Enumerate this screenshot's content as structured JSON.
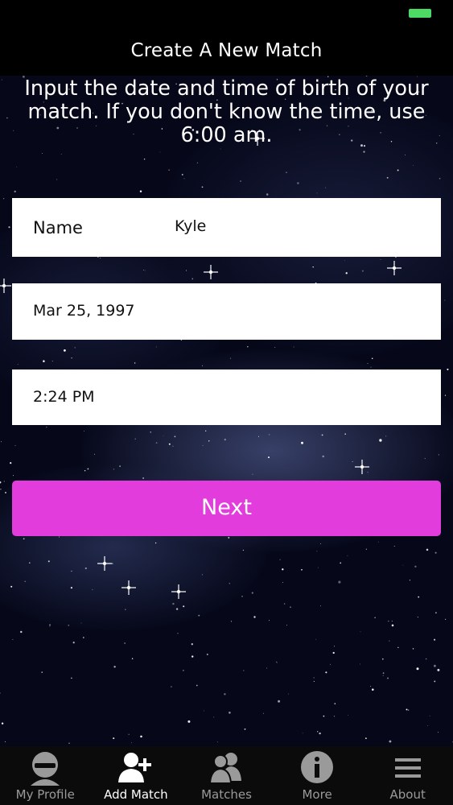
{
  "status_bar": {
    "battery_color": "#4cd964"
  },
  "header": {
    "title": "Create A New Match"
  },
  "instructions": "Input the date and time of birth of your match. If you don't know the time, use 6:00 am.",
  "form": {
    "name_label": "Name",
    "name_value": "Kyle",
    "date_value": "Mar 25, 1997",
    "time_value": "2:24 PM"
  },
  "next_button": {
    "label": "Next",
    "color": "#e23ddc"
  },
  "tabs": [
    {
      "label": "My Profile",
      "icon": "profile-icon",
      "active": false
    },
    {
      "label": "Add Match",
      "icon": "add-user-icon",
      "active": true
    },
    {
      "label": "Matches",
      "icon": "people-icon",
      "active": false
    },
    {
      "label": "More",
      "icon": "info-icon",
      "active": false
    },
    {
      "label": "About",
      "icon": "menu-icon",
      "active": false
    }
  ]
}
